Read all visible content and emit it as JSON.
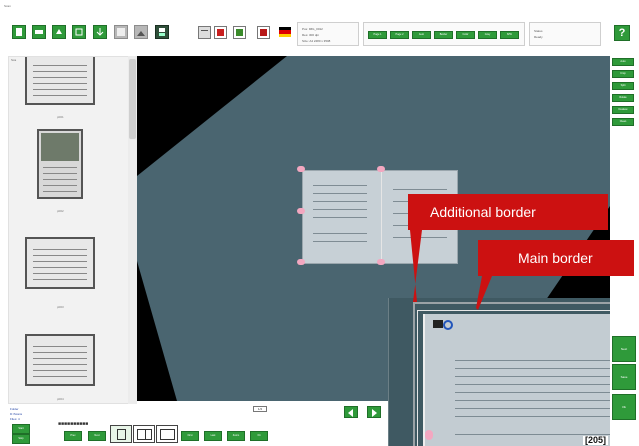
{
  "window": {
    "title": "Scan"
  },
  "toolbar": {
    "buttons": [
      {
        "icon": "page-icon"
      },
      {
        "icon": "scan-icon"
      },
      {
        "icon": "rescan-icon"
      },
      {
        "icon": "crop-icon"
      },
      {
        "icon": "export-icon"
      },
      {
        "icon": "image-icon"
      },
      {
        "icon": "picture-icon"
      },
      {
        "icon": "save-icon"
      }
    ],
    "tool_icons": [
      {
        "icon": "settings-icon"
      },
      {
        "icon": "delete-icon"
      },
      {
        "icon": "color-icon"
      },
      {
        "icon": "red-book-icon"
      }
    ],
    "flag": {
      "icon": "german-flag-icon",
      "colors": [
        "#000000",
        "#dd0000",
        "#ffce00"
      ]
    },
    "info_panel": {
      "line1": "Pos:   IMG_0012",
      "line2": "Res:   300 dpi",
      "line3": "Size:  A4  2480 x 3508"
    },
    "mode_buttons": [
      "Page 1",
      "Page 2",
      "Auto",
      "Border",
      "Color",
      "Gray",
      "B/W"
    ],
    "right_panel": {
      "line1": "Status",
      "line2": "Ready"
    },
    "help": {
      "icon": "help-icon",
      "label": "?"
    }
  },
  "left_panel": {
    "label": "Sca",
    "thumbnails": [
      {
        "caption": "p001"
      },
      {
        "caption": "p002"
      },
      {
        "caption": "p003"
      },
      {
        "caption": "p004"
      }
    ]
  },
  "main_view": {
    "zoom_number": "[205]"
  },
  "callouts": {
    "additional_border": "Additional border",
    "main_border": "Main border"
  },
  "right_buttons": [
    "Auto",
    "Crop",
    "Split",
    "Rotate",
    "Deskew",
    "Clean"
  ],
  "right_bottom": [
    "Next",
    "Save",
    "Ok"
  ],
  "bottom": {
    "info": {
      "line1": "Folder",
      "line2": "D:\\Scans",
      "line3": "Files: 4"
    },
    "buttons": [
      "Start",
      "Stop",
      "Prev",
      "Next"
    ],
    "layout_icons": [
      "single-page-icon",
      "double-page-icon",
      "thumbnail-page-icon"
    ],
    "page_buttons": [
      "First",
      "Last",
      "Zoom",
      "Fit"
    ],
    "counter": "1/4",
    "nav": [
      {
        "icon": "prev-arrow-icon"
      },
      {
        "icon": "next-arrow-icon"
      }
    ]
  },
  "colors": {
    "accent_green": "#2f9a3a",
    "callout_red": "#cc1111",
    "photo_bg": "#3f5962"
  }
}
